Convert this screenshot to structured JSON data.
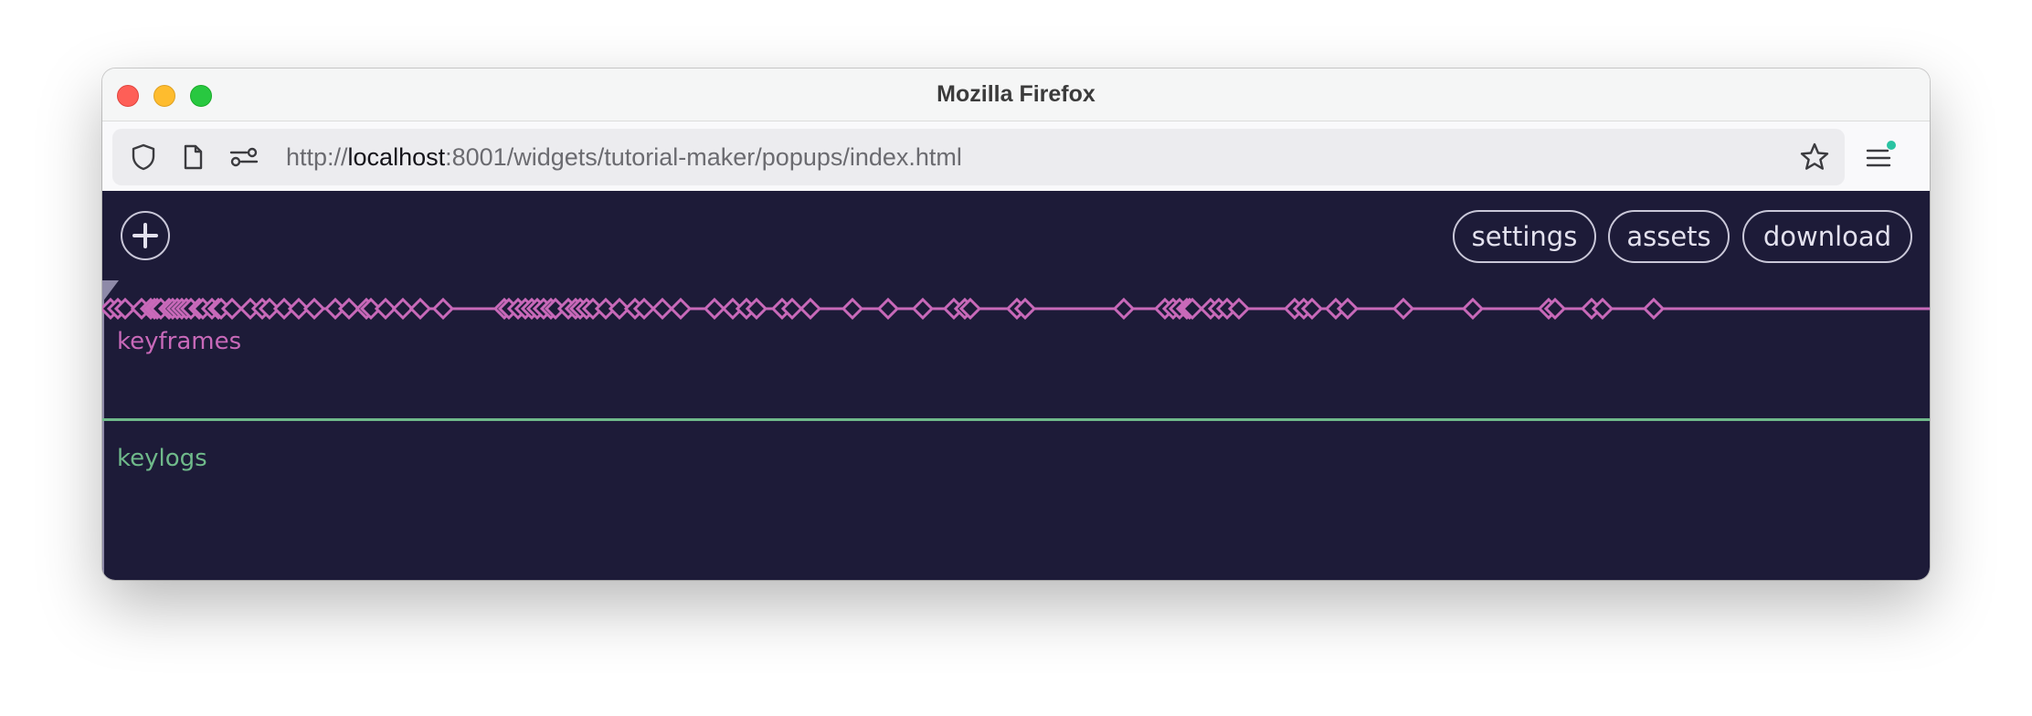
{
  "window": {
    "title": "Mozilla Firefox"
  },
  "urlbar": {
    "scheme": "http://",
    "host": "localhost",
    "path": ":8001/widgets/tutorial-maker/popups/index.html"
  },
  "toolbar": {
    "add_icon": "plus-circle-icon",
    "buttons": [
      {
        "label": "settings"
      },
      {
        "label": "assets"
      },
      {
        "label": "download"
      }
    ]
  },
  "tracks": {
    "keyframes": {
      "label": "keyframes",
      "color": "#c869b9",
      "keyframe_positions": [
        9,
        17,
        25,
        43,
        53,
        57,
        60,
        64,
        73,
        77,
        82,
        87,
        92,
        97,
        106,
        110,
        120,
        127,
        130,
        142,
        162,
        175,
        183,
        199,
        215,
        232,
        255,
        270,
        289,
        294,
        310,
        329,
        348,
        373,
        440,
        445,
        455,
        463,
        470,
        476,
        483,
        491,
        496,
        510,
        518,
        523,
        530,
        537,
        551,
        566,
        583,
        593,
        613,
        633,
        670,
        690,
        705,
        716,
        744,
        755,
        775,
        821,
        860,
        898,
        932,
        944,
        950,
        1001,
        1010,
        1118,
        1163,
        1172,
        1179,
        1187,
        1190,
        1193,
        1213,
        1222,
        1231,
        1244,
        1305,
        1315,
        1324,
        1350,
        1363,
        1424,
        1500,
        1583,
        1590,
        1630,
        1642,
        1698
      ]
    },
    "keylogs": {
      "label": "keylogs",
      "color": "#6fb98a"
    }
  },
  "colors": {
    "app_background": "#1d1b38",
    "keyframes_accent": "#c869b9",
    "keylogs_accent": "#6fb98a",
    "button_border": "#c9c7d8"
  }
}
